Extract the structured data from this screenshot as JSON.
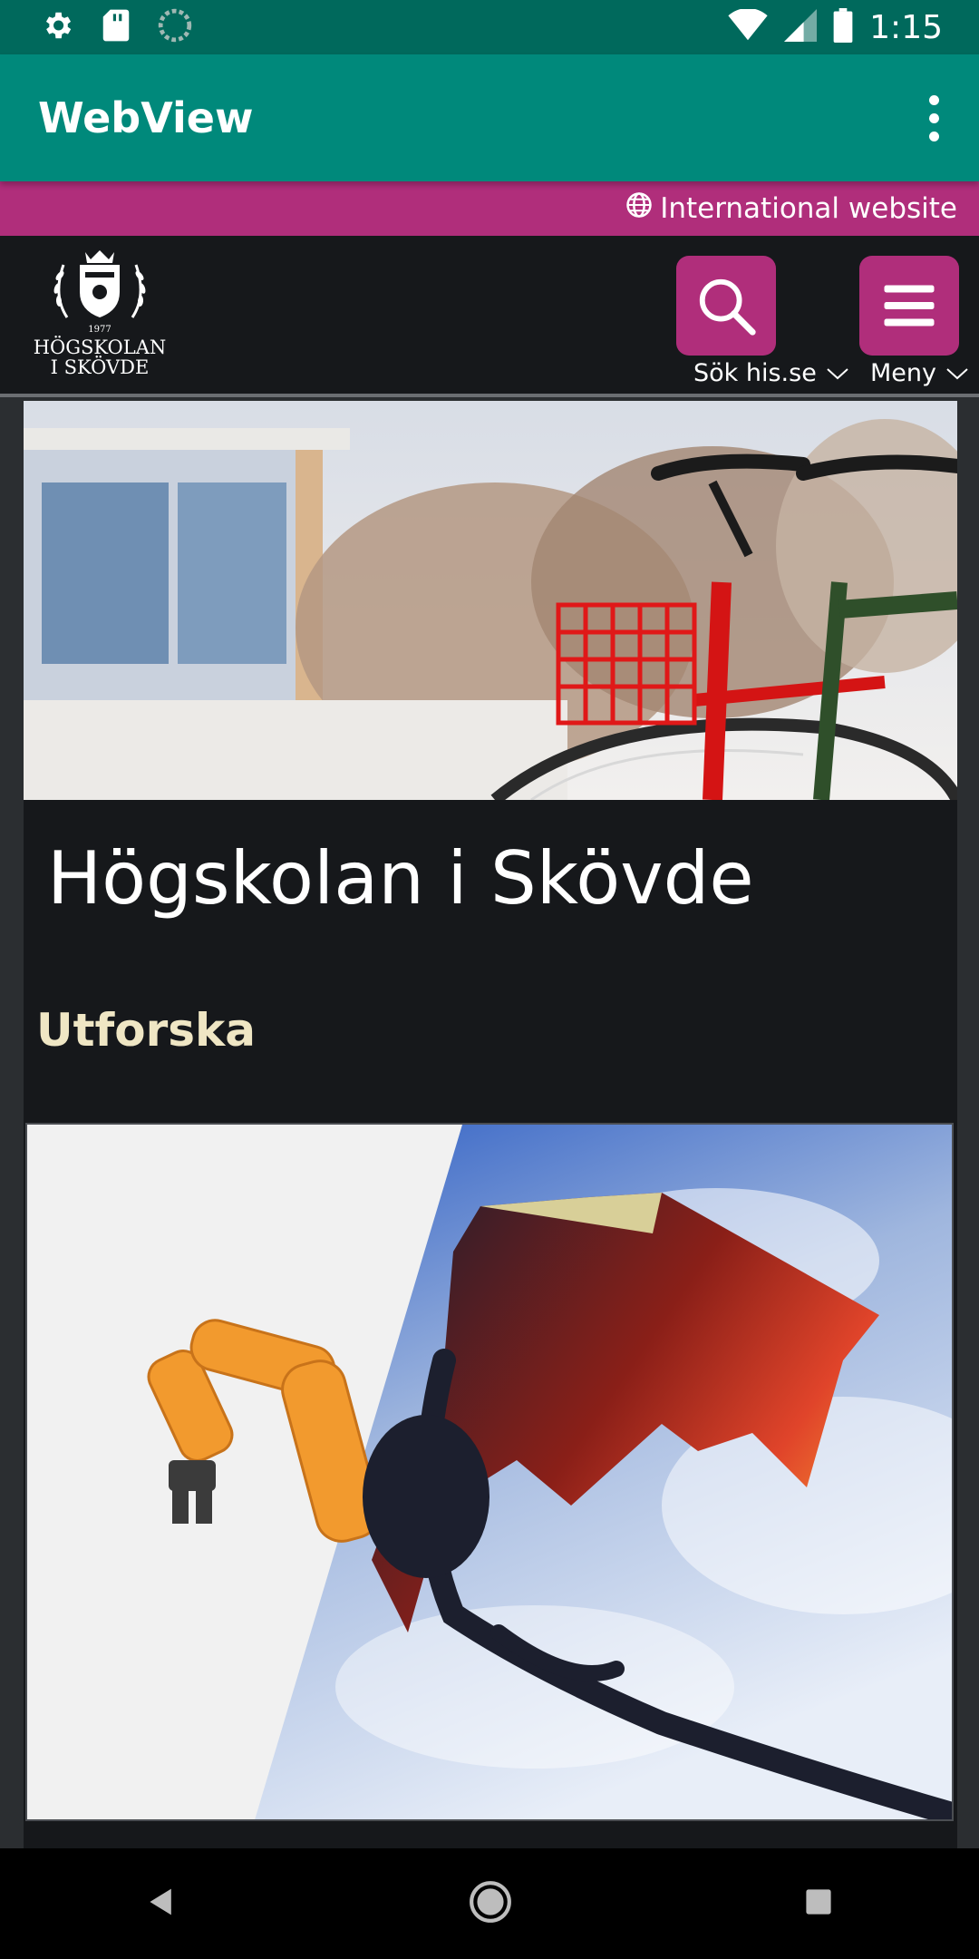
{
  "status_bar": {
    "time": "1:15",
    "icons": [
      "gear-icon",
      "sd-card-icon",
      "sync-icon",
      "wifi-icon",
      "cell-signal-icon",
      "battery-icon"
    ]
  },
  "app_bar": {
    "title": "WebView",
    "overflow_icon": "more-vert-icon"
  },
  "web": {
    "international_link": "International website",
    "logo": {
      "line1": "HÖGSKOLAN",
      "line2": "I SKÖVDE",
      "year": "1977"
    },
    "search": {
      "label": "Sök his.se"
    },
    "menu": {
      "label": "Meny"
    },
    "page_title": "Högskolan i Skövde",
    "section_heading": "Utforska"
  },
  "colors": {
    "status_bar": "#00695c",
    "app_bar": "#00897b",
    "brand_magenta": "#b02e7b",
    "header_dark": "#16181b",
    "heading_cream": "#efe6c4"
  },
  "nav_bar": {
    "back": "back-icon",
    "home": "home-icon",
    "recents": "recents-icon"
  }
}
